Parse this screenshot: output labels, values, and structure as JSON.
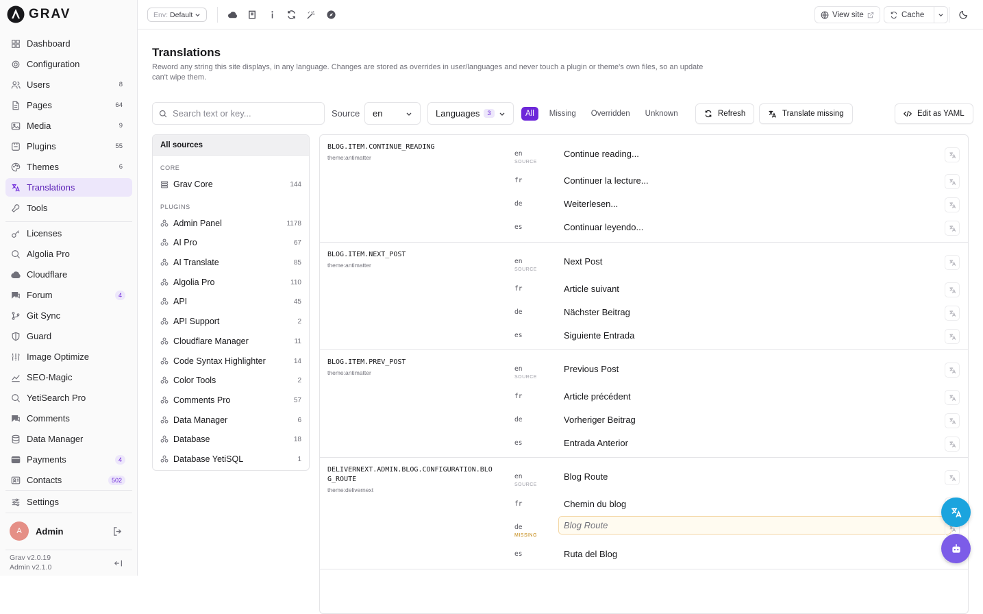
{
  "app": {
    "brand": "GRAV"
  },
  "sidebar": {
    "items": [
      {
        "label": "Dashboard",
        "icon": "dashboard-icon",
        "count": "",
        "badge": ""
      },
      {
        "label": "Configuration",
        "icon": "gear-icon",
        "count": "",
        "badge": ""
      },
      {
        "label": "Users",
        "icon": "users-icon",
        "count": "8",
        "badge": ""
      },
      {
        "label": "Pages",
        "icon": "file-icon",
        "count": "64",
        "badge": ""
      },
      {
        "label": "Media",
        "icon": "image-icon",
        "count": "9",
        "badge": ""
      },
      {
        "label": "Plugins",
        "icon": "plug-icon",
        "count": "55",
        "badge": ""
      },
      {
        "label": "Themes",
        "icon": "palette-icon",
        "count": "6",
        "badge": ""
      },
      {
        "label": "Translations",
        "icon": "translate-icon",
        "count": "",
        "badge": "",
        "active": true
      },
      {
        "label": "Tools",
        "icon": "wrench-icon",
        "count": "",
        "badge": ""
      },
      {
        "label": "Licenses",
        "icon": "key-icon",
        "count": "",
        "badge": ""
      },
      {
        "label": "Algolia Pro",
        "icon": "search-icon",
        "count": "",
        "badge": ""
      },
      {
        "label": "Cloudflare",
        "icon": "cloud-icon",
        "count": "",
        "badge": ""
      },
      {
        "label": "Forum",
        "icon": "chat-icon",
        "count": "",
        "badge": "4"
      },
      {
        "label": "Git Sync",
        "icon": "git-icon",
        "count": "",
        "badge": ""
      },
      {
        "label": "Guard",
        "icon": "shield-icon",
        "count": "",
        "badge": ""
      },
      {
        "label": "Image Optimize",
        "icon": "sliders-icon",
        "count": "",
        "badge": ""
      },
      {
        "label": "SEO-Magic",
        "icon": "trend-icon",
        "count": "",
        "badge": ""
      },
      {
        "label": "YetiSearch Pro",
        "icon": "search-icon",
        "count": "",
        "badge": ""
      },
      {
        "label": "Comments",
        "icon": "comment-icon",
        "count": "",
        "badge": ""
      },
      {
        "label": "Data Manager",
        "icon": "database-icon",
        "count": "",
        "badge": ""
      },
      {
        "label": "Payments",
        "icon": "card-icon",
        "count": "",
        "badge": "4"
      },
      {
        "label": "Contacts",
        "icon": "contact-icon",
        "count": "",
        "badge": "502"
      },
      {
        "label": "Settings",
        "icon": "settings-icon",
        "count": "",
        "badge": ""
      }
    ],
    "user": {
      "initial": "A",
      "name": "Admin"
    },
    "version_grav": "Grav v2.0.19",
    "version_admin": "Admin v2.1.0"
  },
  "topbar": {
    "env_label": "Env:",
    "env_value": "Default",
    "view_site": "View site",
    "cache": "Cache"
  },
  "page": {
    "title": "Translations",
    "description": "Reword any string this site displays, in any language. Changes are stored as overrides in user/languages and never touch a plugin or theme's own files, so an update can't wipe them."
  },
  "toolbar": {
    "search_placeholder": "Search text or key...",
    "source_label": "Source",
    "source_value": "en",
    "languages_label": "Languages",
    "languages_count": "3",
    "filters": [
      "All",
      "Missing",
      "Overridden",
      "Unknown"
    ],
    "active_filter": "All",
    "refresh": "Refresh",
    "translate_missing": "Translate missing",
    "edit_yaml": "Edit as YAML"
  },
  "sources": {
    "all_label": "All sources",
    "core_heading": "CORE",
    "core": [
      {
        "name": "Grav Core",
        "count": "144"
      }
    ],
    "plugins_heading": "PLUGINS",
    "plugins": [
      {
        "name": "Admin Panel",
        "count": "1178"
      },
      {
        "name": "AI Pro",
        "count": "67"
      },
      {
        "name": "AI Translate",
        "count": "85"
      },
      {
        "name": "Algolia Pro",
        "count": "110"
      },
      {
        "name": "API",
        "count": "45"
      },
      {
        "name": "API Support",
        "count": "2"
      },
      {
        "name": "Cloudflare Manager",
        "count": "11"
      },
      {
        "name": "Code Syntax Highlighter",
        "count": "14"
      },
      {
        "name": "Color Tools",
        "count": "2"
      },
      {
        "name": "Comments Pro",
        "count": "57"
      },
      {
        "name": "Data Manager",
        "count": "6"
      },
      {
        "name": "Database",
        "count": "18"
      },
      {
        "name": "Database YetiSQL",
        "count": "1"
      }
    ]
  },
  "entries": [
    {
      "key": "BLOG.ITEM.CONTINUE_READING",
      "source": "theme:antimatter",
      "rows": [
        {
          "lang": "en",
          "sub": "SOURCE",
          "value": "Continue reading..."
        },
        {
          "lang": "fr",
          "sub": "",
          "value": "Continuer la lecture..."
        },
        {
          "lang": "de",
          "sub": "",
          "value": "Weiterlesen..."
        },
        {
          "lang": "es",
          "sub": "",
          "value": "Continuar leyendo..."
        }
      ]
    },
    {
      "key": "BLOG.ITEM.NEXT_POST",
      "source": "theme:antimatter",
      "rows": [
        {
          "lang": "en",
          "sub": "SOURCE",
          "value": "Next Post"
        },
        {
          "lang": "fr",
          "sub": "",
          "value": "Article suivant"
        },
        {
          "lang": "de",
          "sub": "",
          "value": "Nächster Beitrag"
        },
        {
          "lang": "es",
          "sub": "",
          "value": "Siguiente Entrada"
        }
      ]
    },
    {
      "key": "BLOG.ITEM.PREV_POST",
      "source": "theme:antimatter",
      "rows": [
        {
          "lang": "en",
          "sub": "SOURCE",
          "value": "Previous Post"
        },
        {
          "lang": "fr",
          "sub": "",
          "value": "Article précédent"
        },
        {
          "lang": "de",
          "sub": "",
          "value": "Vorheriger Beitrag"
        },
        {
          "lang": "es",
          "sub": "",
          "value": "Entrada Anterior"
        }
      ]
    },
    {
      "key": "DELIVERNEXT.ADMIN.BLOG.CONFIGURATION.BLOG_ROUTE",
      "source": "theme:delivernext",
      "rows": [
        {
          "lang": "en",
          "sub": "SOURCE",
          "value": "Blog Route"
        },
        {
          "lang": "fr",
          "sub": "",
          "value": "Chemin du blog"
        },
        {
          "lang": "de",
          "sub": "MISSING",
          "value": "",
          "placeholder": "Blog Route"
        },
        {
          "lang": "es",
          "sub": "",
          "value": "Ruta del Blog"
        }
      ]
    }
  ],
  "colors": {
    "accent": "#6d28d9",
    "active_bg": "#ede7fb",
    "fab_translate": "#1ba4de",
    "fab_bot": "#7c5ce8"
  }
}
